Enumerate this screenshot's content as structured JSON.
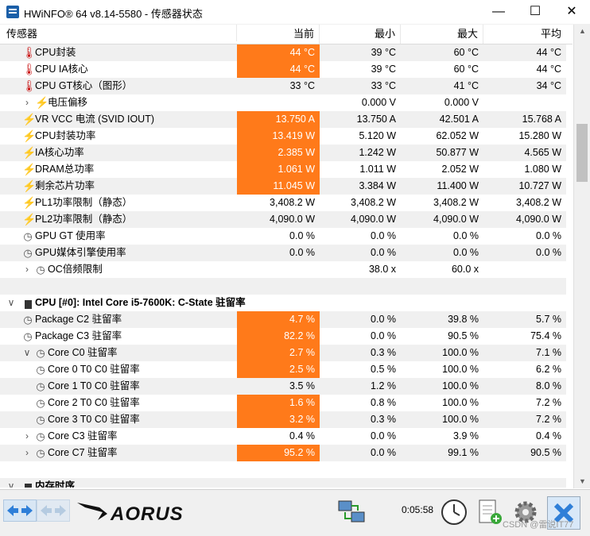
{
  "window": {
    "title": "HWiNFO® 64 v8.14-5580 - 传感器状态",
    "minimize_glyph": "—",
    "maximize_glyph": "☐",
    "close_glyph": "✕"
  },
  "header": {
    "name": "传感器",
    "current": "当前",
    "min": "最小",
    "max": "最大",
    "avg": "平均"
  },
  "rows": [
    {
      "label": "CPU封装",
      "icon": "thermometer-icon",
      "level": 1,
      "cur": "44 °C",
      "min": "39 °C",
      "max": "60 °C",
      "avg": "44 °C",
      "hl": true
    },
    {
      "label": "CPU IA核心",
      "icon": "thermometer-icon",
      "level": 1,
      "cur": "44 °C",
      "min": "39 °C",
      "max": "60 °C",
      "avg": "44 °C",
      "hl": true
    },
    {
      "label": "CPU GT核心（图形）",
      "icon": "thermometer-icon",
      "level": 1,
      "cur": "33 °C",
      "min": "33 °C",
      "max": "41 °C",
      "avg": "34 °C",
      "hl": false
    },
    {
      "label": "电压偏移",
      "icon": "bolt-icon",
      "level": 2,
      "expander": true,
      "cur": "",
      "min": "0.000 V",
      "max": "0.000 V",
      "avg": "",
      "hl": false
    },
    {
      "label": "VR VCC 电流 (SVID IOUT)",
      "icon": "bolt-icon",
      "level": 1,
      "cur": "13.750 A",
      "min": "13.750 A",
      "max": "42.501 A",
      "avg": "15.768 A",
      "hl": true
    },
    {
      "label": "CPU封装功率",
      "icon": "bolt-icon",
      "level": 1,
      "cur": "13.419 W",
      "min": "5.120 W",
      "max": "62.052 W",
      "avg": "15.280 W",
      "hl": true
    },
    {
      "label": "IA核心功率",
      "icon": "bolt-icon",
      "level": 1,
      "cur": "2.385 W",
      "min": "1.242 W",
      "max": "50.877 W",
      "avg": "4.565 W",
      "hl": true
    },
    {
      "label": "DRAM总功率",
      "icon": "bolt-icon",
      "level": 1,
      "cur": "1.061 W",
      "min": "1.011 W",
      "max": "2.052 W",
      "avg": "1.080 W",
      "hl": true
    },
    {
      "label": "剩余芯片功率",
      "icon": "bolt-icon",
      "level": 1,
      "cur": "11.045 W",
      "min": "3.384 W",
      "max": "11.400 W",
      "avg": "10.727 W",
      "hl": true
    },
    {
      "label": "PL1功率限制（静态）",
      "icon": "bolt-icon",
      "level": 1,
      "cur": "3,408.2 W",
      "min": "3,408.2 W",
      "max": "3,408.2 W",
      "avg": "3,408.2 W",
      "hl": false
    },
    {
      "label": "PL2功率限制（静态）",
      "icon": "bolt-icon",
      "level": 1,
      "cur": "4,090.0 W",
      "min": "4,090.0 W",
      "max": "4,090.0 W",
      "avg": "4,090.0 W",
      "hl": false
    },
    {
      "label": "GPU GT 使用率",
      "icon": "clock-icon",
      "level": 1,
      "cur": "0.0 %",
      "min": "0.0 %",
      "max": "0.0 %",
      "avg": "0.0 %",
      "hl": false
    },
    {
      "label": "GPU媒体引擎使用率",
      "icon": "clock-icon",
      "level": 1,
      "cur": "0.0 %",
      "min": "0.0 %",
      "max": "0.0 %",
      "avg": "0.0 %",
      "hl": false
    },
    {
      "label": "OC倍频限制",
      "icon": "clock-icon",
      "level": 2,
      "expander": true,
      "cur": "",
      "min": "38.0 x",
      "max": "60.0 x",
      "avg": "",
      "hl": false
    },
    {
      "label": "",
      "icon": "",
      "level": 0,
      "cur": "",
      "min": "",
      "max": "",
      "avg": "",
      "hl": false,
      "blank": true
    },
    {
      "label": "CPU [#0]: Intel Core i5-7600K: C-State 驻留率",
      "icon": "chip-icon",
      "level": 0,
      "group": true,
      "expanded": true,
      "cur": "",
      "min": "",
      "max": "",
      "avg": "",
      "hl": false
    },
    {
      "label": "Package C2 驻留率",
      "icon": "clock-icon",
      "level": 1,
      "cur": "4.7 %",
      "min": "0.0 %",
      "max": "39.8 %",
      "avg": "5.7 %",
      "hl": true
    },
    {
      "label": "Package C3 驻留率",
      "icon": "clock-icon",
      "level": 1,
      "cur": "82.2 %",
      "min": "0.0 %",
      "max": "90.5 %",
      "avg": "75.4 %",
      "hl": true
    },
    {
      "label": "Core C0 驻留率",
      "icon": "clock-icon",
      "level": 2,
      "expander": true,
      "expanded": true,
      "cur": "2.7 %",
      "min": "0.3 %",
      "max": "100.0 %",
      "avg": "7.1 %",
      "hl": true
    },
    {
      "label": "Core 0 T0 C0 驻留率",
      "icon": "clock-icon",
      "level": 3,
      "cur": "2.5 %",
      "min": "0.5 %",
      "max": "100.0 %",
      "avg": "6.2 %",
      "hl": true
    },
    {
      "label": "Core 1 T0 C0 驻留率",
      "icon": "clock-icon",
      "level": 3,
      "cur": "3.5 %",
      "min": "1.2 %",
      "max": "100.0 %",
      "avg": "8.0 %",
      "hl": false
    },
    {
      "label": "Core 2 T0 C0 驻留率",
      "icon": "clock-icon",
      "level": 3,
      "cur": "1.6 %",
      "min": "0.8 %",
      "max": "100.0 %",
      "avg": "7.2 %",
      "hl": true
    },
    {
      "label": "Core 3 T0 C0 驻留率",
      "icon": "clock-icon",
      "level": 3,
      "cur": "3.2 %",
      "min": "0.3 %",
      "max": "100.0 %",
      "avg": "7.2 %",
      "hl": true
    },
    {
      "label": "Core C3 驻留率",
      "icon": "clock-icon",
      "level": 2,
      "expander": true,
      "cur": "0.4 %",
      "min": "0.0 %",
      "max": "3.9 %",
      "avg": "0.4 %",
      "hl": false
    },
    {
      "label": "Core C7 驻留率",
      "icon": "clock-icon",
      "level": 2,
      "expander": true,
      "cur": "95.2 %",
      "min": "0.0 %",
      "max": "99.1 %",
      "avg": "90.5 %",
      "hl": true
    },
    {
      "label": "",
      "icon": "",
      "level": 0,
      "cur": "",
      "min": "",
      "max": "",
      "avg": "",
      "hl": false,
      "blank": true
    },
    {
      "label": "内存时序",
      "icon": "chip-icon",
      "level": 0,
      "group": true,
      "expanded": true,
      "cur": "",
      "min": "",
      "max": "",
      "avg": "",
      "hl": false
    }
  ],
  "toolbar": {
    "elapsed": "0:05:58",
    "logo_text": "AORUS",
    "watermark": "CSDN @雷说IT77"
  },
  "colors": {
    "highlight": "#ff7a1a",
    "alt_row": "#f0f0f0"
  }
}
